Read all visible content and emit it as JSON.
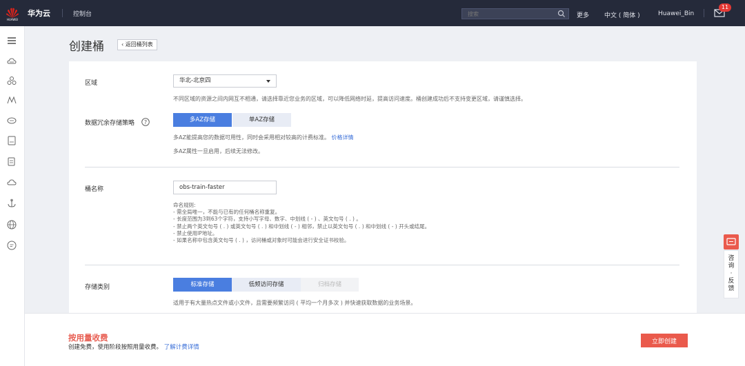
{
  "topbar": {
    "logo_text": "HUAWEI",
    "brand": "华为云",
    "console": "控制台",
    "search_placeholder": "搜索",
    "more": "更多",
    "language": "中文 ( 简体 )",
    "user": "Huawei_Bin",
    "mail_badge": "11"
  },
  "page": {
    "title": "创建桶",
    "back_label": "返回桶列表"
  },
  "form": {
    "region_label": "区域",
    "region_value": "华北-北京四",
    "region_hint": "不同区域的资源之间内网互不相通，请选择靠近您业务的区域，可以降低网络时延，提高访问速度。桶创建成功后不支持变更区域，请谨慎选择。",
    "redundancy_label": "数据冗余存储策略",
    "redundancy_options": [
      "多AZ存储",
      "单AZ存储"
    ],
    "redundancy_hint1": "多AZ能提高您的数据可用性，同时会采用相对较高的计费标准。",
    "redundancy_hint_link": "价格详情",
    "redundancy_hint2": "多AZ属性一旦启用，后续无法修改。",
    "name_label": "桶名称",
    "name_value": "obs-train-faster",
    "rules": [
      "命名规则:",
      "- 需全局唯一，不能与已有的任何桶名称重复。",
      "- 长度范围为3到63个字符，支持小写字母、数字、中划线 ( - ) 、英文句号 ( . ) 。",
      "- 禁止两个英文句号 ( . ) 或英文句号 ( . ) 和中划线 ( - ) 相邻，禁止以英文句号 ( . ) 和中划线 ( - ) 开头或结尾。",
      "- 禁止使用IP地址。",
      "- 如果名称中包含英文句号 ( . ) ，访问桶或对象时可能会进行安全证书校验。"
    ],
    "storage_label": "存储类别",
    "storage_options": [
      "标准存储",
      "低频访问存储",
      "归档存储"
    ],
    "storage_hint": "适用于有大量热点文件或小文件，且需要频繁访问 ( 平均一个月多次 ) 并快速获取数据的业务场景。"
  },
  "footer": {
    "price_title": "按用量收费",
    "price_desc": "创建免费，使用阶段按照用量收费。",
    "price_link": "了解计费详情",
    "create_label": "立即创建"
  },
  "float": {
    "feedback_chars": [
      "咨",
      "询",
      "·",
      "反",
      "馈"
    ]
  },
  "colors": {
    "topbar_bg": "#252a3a",
    "accent_blue": "#4a7ee0",
    "accent_red": "#ea5a4c",
    "link_blue": "#3a6fd8"
  }
}
